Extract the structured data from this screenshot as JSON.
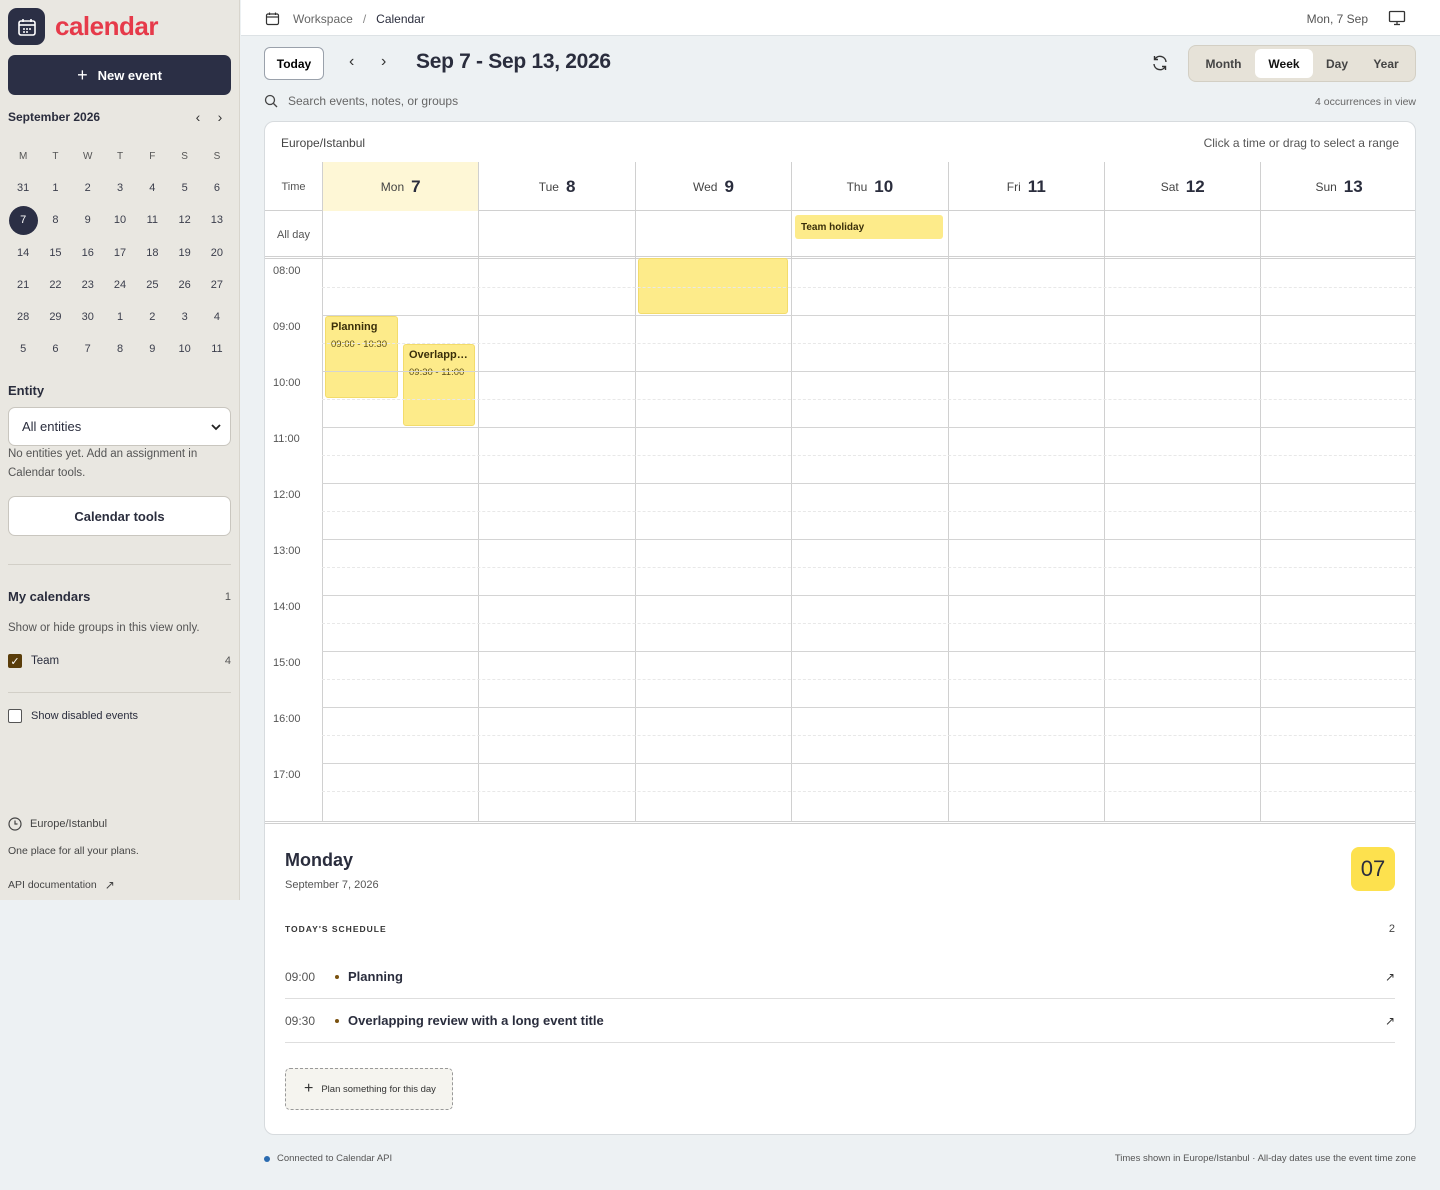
{
  "app": {
    "name": "calendar"
  },
  "sidebar": {
    "new_event_label": "New event",
    "mini_calendar": {
      "title": "September 2026",
      "weekdays": [
        "M",
        "T",
        "W",
        "T",
        "F",
        "S",
        "S"
      ],
      "weeks": [
        [
          "31",
          "1",
          "2",
          "3",
          "4",
          "5",
          "6"
        ],
        [
          "7",
          "8",
          "9",
          "10",
          "11",
          "12",
          "13"
        ],
        [
          "14",
          "15",
          "16",
          "17",
          "18",
          "19",
          "20"
        ],
        [
          "21",
          "22",
          "23",
          "24",
          "25",
          "26",
          "27"
        ],
        [
          "28",
          "29",
          "30",
          "1",
          "2",
          "3",
          "4"
        ],
        [
          "5",
          "6",
          "7",
          "8",
          "9",
          "10",
          "11"
        ]
      ],
      "selected": "7"
    },
    "entity": {
      "label": "Entity",
      "selected": "All entities",
      "help": "No entities yet. Add an assignment in Calendar tools."
    },
    "tools_label": "Calendar tools",
    "my_calendars": {
      "label": "My calendars",
      "count": "1",
      "help": "Show or hide groups in this view only.",
      "items": [
        {
          "name": "Team",
          "count": "4",
          "checked": true
        }
      ]
    },
    "show_disabled_label": "Show disabled events",
    "footer": {
      "timezone": "Europe/Istanbul",
      "tagline": "One place for all your plans.",
      "api_link": "API documentation"
    }
  },
  "topbar": {
    "breadcrumb": [
      "Workspace",
      "Calendar"
    ],
    "date": "Mon, 7 Sep"
  },
  "toolbar": {
    "today_label": "Today",
    "range_title": "Sep 7 - Sep 13, 2026",
    "views": [
      "Month",
      "Week",
      "Day",
      "Year"
    ],
    "active_view": "Week",
    "search_placeholder": "Search events, notes, or groups",
    "occurrences": "4 occurrences in view"
  },
  "grid": {
    "timezone": "Europe/Istanbul",
    "hint": "Click a time or drag to select a range",
    "time_label": "Time",
    "allday_label": "All day",
    "days": [
      {
        "name": "Mon",
        "num": "7"
      },
      {
        "name": "Tue",
        "num": "8"
      },
      {
        "name": "Wed",
        "num": "9"
      },
      {
        "name": "Thu",
        "num": "10"
      },
      {
        "name": "Fri",
        "num": "11"
      },
      {
        "name": "Sat",
        "num": "12"
      },
      {
        "name": "Sun",
        "num": "13"
      }
    ],
    "today_index": 0,
    "hours": [
      "08:00",
      "09:00",
      "10:00",
      "11:00",
      "12:00",
      "13:00",
      "14:00",
      "15:00",
      "16:00",
      "17:00"
    ],
    "allday_event": "Team holiday",
    "events": [
      {
        "title": "Planning",
        "time": "09:00 - 10:30"
      },
      {
        "title": "Overlapping review with a long event title",
        "time": "09:30 - 11:00"
      }
    ]
  },
  "detail": {
    "weekday": "Monday",
    "date": "September 7, 2026",
    "day_num": "07",
    "schedule_label": "TODAY'S SCHEDULE",
    "schedule_count": "2",
    "items": [
      {
        "time": "09:00",
        "title": "Planning"
      },
      {
        "time": "09:30",
        "title": "Overlapping review with a long event title"
      }
    ],
    "plan_label": "Plan something for this day"
  },
  "footer": {
    "status": "Connected to Calendar API",
    "note": "Times shown in Europe/Istanbul · All-day dates use the event time zone"
  },
  "colors": {
    "primary": "#2b2f45",
    "brand": "#e63a4a",
    "event": "#fdeb8a",
    "today_bg": "#fef7d6",
    "badge": "#fde14e"
  }
}
